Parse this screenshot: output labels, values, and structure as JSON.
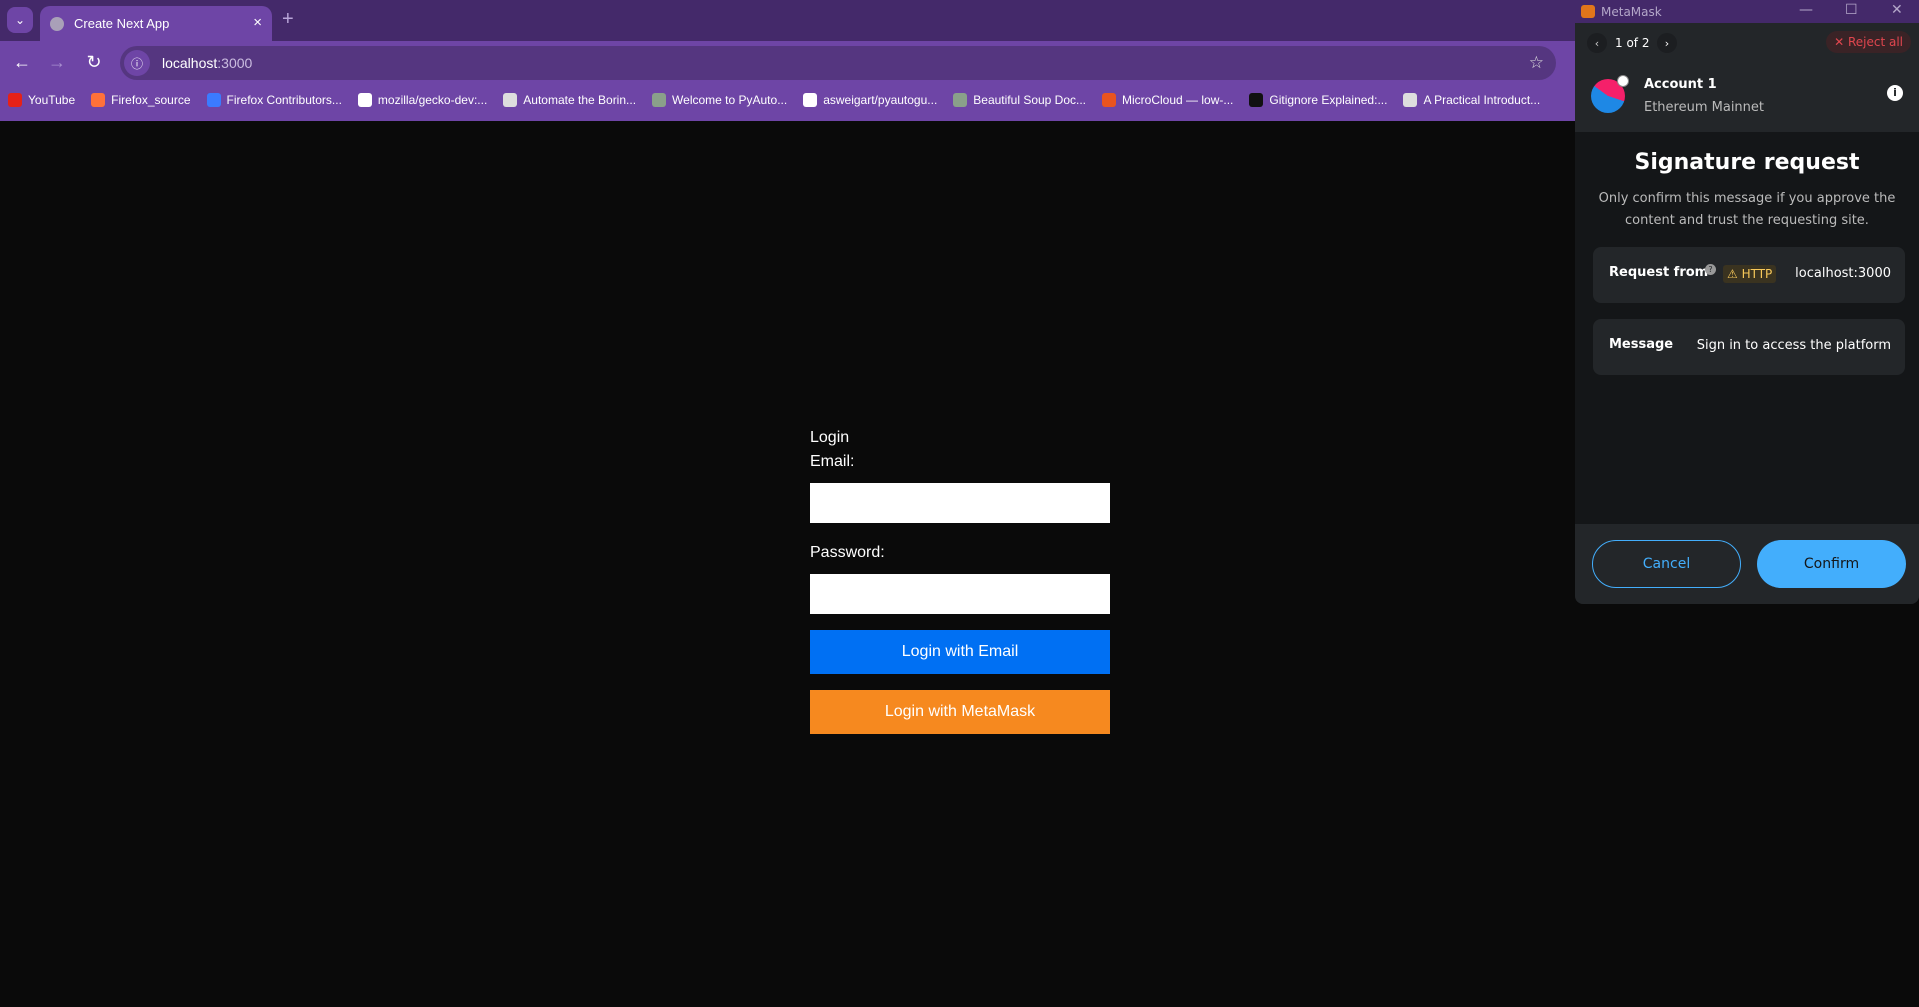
{
  "browser": {
    "tab": {
      "title": "Create Next App",
      "close": "×"
    },
    "new_tab": "+",
    "url_host": "localhost",
    "url_port": ":3000",
    "bookmarks": [
      {
        "label": "YouTube",
        "color": "#e62117"
      },
      {
        "label": "Firefox_source",
        "color": "#ff7139"
      },
      {
        "label": "Firefox Contributors...",
        "color": "#3b7bff"
      },
      {
        "label": "mozilla/gecko-dev:...",
        "color": "#ffffff"
      },
      {
        "label": "Automate the Borin...",
        "color": "#dddddd"
      },
      {
        "label": "Welcome to PyAuto...",
        "color": "#8aa08a"
      },
      {
        "label": "asweigart/pyautogu...",
        "color": "#ffffff"
      },
      {
        "label": "Beautiful Soup Doc...",
        "color": "#8aa08a"
      },
      {
        "label": "MicroCloud — low-...",
        "color": "#e95420"
      },
      {
        "label": "Gitignore Explained:...",
        "color": "#111111"
      },
      {
        "label": "A Practical Introduct...",
        "color": "#dddddd"
      }
    ]
  },
  "login": {
    "title": "Login",
    "email_label": "Email:",
    "email_value": "",
    "password_label": "Password:",
    "password_value": "",
    "email_button": "Login with Email",
    "metamask_button": "Login with MetaMask",
    "email_button_color": "#0070f3",
    "metamask_button_color": "#f6891f"
  },
  "metamask": {
    "window_title": "MetaMask",
    "pager": "1 of 2",
    "reject_all": "✕ Reject all",
    "account_name": "Account 1",
    "network": "Ethereum Mainnet",
    "title": "Signature request",
    "description": "Only confirm this message if you approve the content and trust the requesting site.",
    "request_from_label": "Request from",
    "http_badge": "⚠ HTTP",
    "request_origin": "localhost:3000",
    "message_label": "Message",
    "message_value": "Sign in to access the platform",
    "cancel": "Cancel",
    "confirm": "Confirm",
    "accent": "#43aefc"
  }
}
